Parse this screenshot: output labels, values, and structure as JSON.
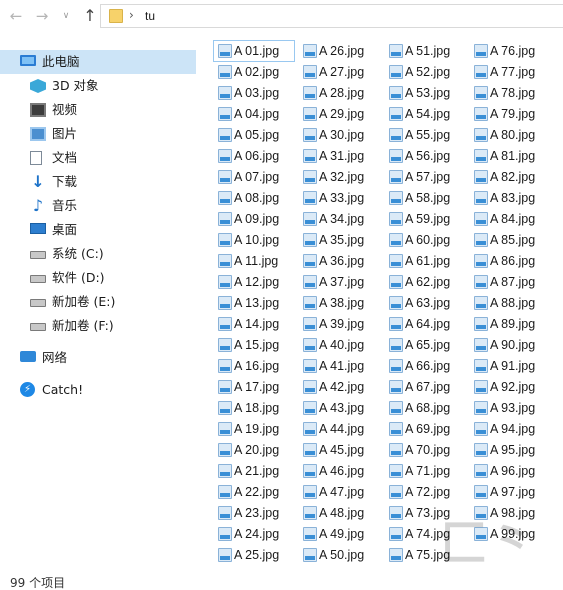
{
  "address_bar": {
    "back_glyph": "←",
    "forward_glyph": "→",
    "dropdown_glyph": "∨",
    "up_glyph": "↑",
    "separator": "›",
    "current_folder": "tu"
  },
  "sidebar": {
    "items": [
      {
        "label": "此电脑",
        "icon": "computer-icon"
      },
      {
        "label": "3D 对象",
        "icon": "3d-objects-icon"
      },
      {
        "label": "视频",
        "icon": "video-icon"
      },
      {
        "label": "图片",
        "icon": "pictures-icon"
      },
      {
        "label": "文档",
        "icon": "documents-icon"
      },
      {
        "label": "下载",
        "icon": "download-icon"
      },
      {
        "label": "音乐",
        "icon": "music-icon"
      },
      {
        "label": "桌面",
        "icon": "desktop-icon"
      },
      {
        "label": "系统 (C:)",
        "icon": "system-drive-icon"
      },
      {
        "label": "软件 (D:)",
        "icon": "drive-icon"
      },
      {
        "label": "新加卷 (E:)",
        "icon": "drive-icon"
      },
      {
        "label": "新加卷 (F:)",
        "icon": "drive-icon"
      },
      {
        "label": "网络",
        "icon": "network-icon"
      },
      {
        "label": "Catch!",
        "icon": "catch-icon"
      }
    ],
    "selected_index": 0
  },
  "files": [
    "A 01.jpg",
    "A 02.jpg",
    "A 03.jpg",
    "A 04.jpg",
    "A 05.jpg",
    "A 06.jpg",
    "A 07.jpg",
    "A 08.jpg",
    "A 09.jpg",
    "A 10.jpg",
    "A 11.jpg",
    "A 12.jpg",
    "A 13.jpg",
    "A 14.jpg",
    "A 15.jpg",
    "A 16.jpg",
    "A 17.jpg",
    "A 18.jpg",
    "A 19.jpg",
    "A 20.jpg",
    "A 21.jpg",
    "A 22.jpg",
    "A 23.jpg",
    "A 24.jpg",
    "A 25.jpg",
    "A 26.jpg",
    "A 27.jpg",
    "A 28.jpg",
    "A 29.jpg",
    "A 30.jpg",
    "A 31.jpg",
    "A 32.jpg",
    "A 33.jpg",
    "A 34.jpg",
    "A 35.jpg",
    "A 36.jpg",
    "A 37.jpg",
    "A 38.jpg",
    "A 39.jpg",
    "A 40.jpg",
    "A 41.jpg",
    "A 42.jpg",
    "A 43.jpg",
    "A 44.jpg",
    "A 45.jpg",
    "A 46.jpg",
    "A 47.jpg",
    "A 48.jpg",
    "A 49.jpg",
    "A 50.jpg",
    "A 51.jpg",
    "A 52.jpg",
    "A 53.jpg",
    "A 54.jpg",
    "A 55.jpg",
    "A 56.jpg",
    "A 57.jpg",
    "A 58.jpg",
    "A 59.jpg",
    "A 60.jpg",
    "A 61.jpg",
    "A 62.jpg",
    "A 63.jpg",
    "A 64.jpg",
    "A 65.jpg",
    "A 66.jpg",
    "A 67.jpg",
    "A 68.jpg",
    "A 69.jpg",
    "A 70.jpg",
    "A 71.jpg",
    "A 72.jpg",
    "A 73.jpg",
    "A 74.jpg",
    "A 75.jpg",
    "A 76.jpg",
    "A 77.jpg",
    "A 78.jpg",
    "A 79.jpg",
    "A 80.jpg",
    "A 81.jpg",
    "A 82.jpg",
    "A 83.jpg",
    "A 84.jpg",
    "A 85.jpg",
    "A 86.jpg",
    "A 87.jpg",
    "A 88.jpg",
    "A 89.jpg",
    "A 90.jpg",
    "A 91.jpg",
    "A 92.jpg",
    "A 93.jpg",
    "A 94.jpg",
    "A 95.jpg",
    "A 96.jpg",
    "A 97.jpg",
    "A 98.jpg",
    "A 99.jpg"
  ],
  "file_icon": "jpg-file-icon",
  "focused_file_index": 0,
  "status_bar": {
    "item_count": "99 个项目"
  },
  "colors": {
    "selection": "#cce4f7",
    "accent": "#2b7cd3"
  }
}
